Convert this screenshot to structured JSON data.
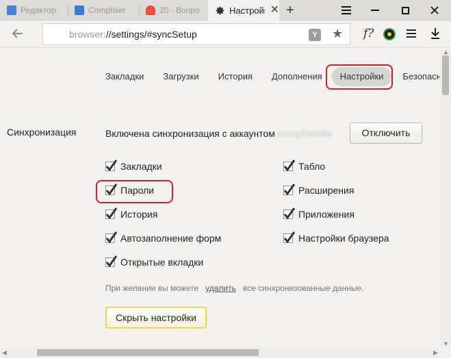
{
  "tabs": [
    {
      "label": "Редактор",
      "favicon_color": "#4a7fd4"
    },
    {
      "label": "Compfixer",
      "favicon_color": "#3c78d8"
    },
    {
      "label": "20 - Вопро",
      "favicon_color": "#e8503a"
    },
    {
      "label": "Настройк",
      "active": true
    }
  ],
  "window_controls": {
    "menu": "hamburger-icon",
    "minimize": "minimize-icon",
    "maximize": "maximize-icon",
    "close": "close-icon"
  },
  "address": {
    "scheme": "browser:",
    "rest": "//settings/#syncSetup",
    "yandex_button": "Y"
  },
  "toolbar": {
    "fx_label": "f?"
  },
  "nav": {
    "items": [
      "Закладки",
      "Загрузки",
      "История",
      "Дополнения",
      "Настройки",
      "Безопасн"
    ],
    "active_index": 4
  },
  "sync": {
    "section_title": "Синхронизация",
    "status_text": "Включена синхронизация с аккаунтом",
    "account": "compfixerlife",
    "disable_button": "Отключить",
    "left_options": [
      {
        "label": "Закладки",
        "checked": true
      },
      {
        "label": "Пароли",
        "checked": true
      },
      {
        "label": "История",
        "checked": true
      },
      {
        "label": "Автозаполнение форм",
        "checked": true
      },
      {
        "label": "Открытые вкладки",
        "checked": true
      }
    ],
    "right_options": [
      {
        "label": "Табло",
        "checked": true
      },
      {
        "label": "Расширения",
        "checked": true
      },
      {
        "label": "Приложения",
        "checked": true
      },
      {
        "label": "Настройки браузера",
        "checked": true
      }
    ],
    "hint_before": "При желании вы можете",
    "hint_link": "удалить",
    "hint_after": "все синхронизованные данные.",
    "hide_button": "Скрыть настройки"
  },
  "colors": {
    "highlight": "#d0202a",
    "check": "#333333",
    "accent_border": "#f1d35a"
  }
}
